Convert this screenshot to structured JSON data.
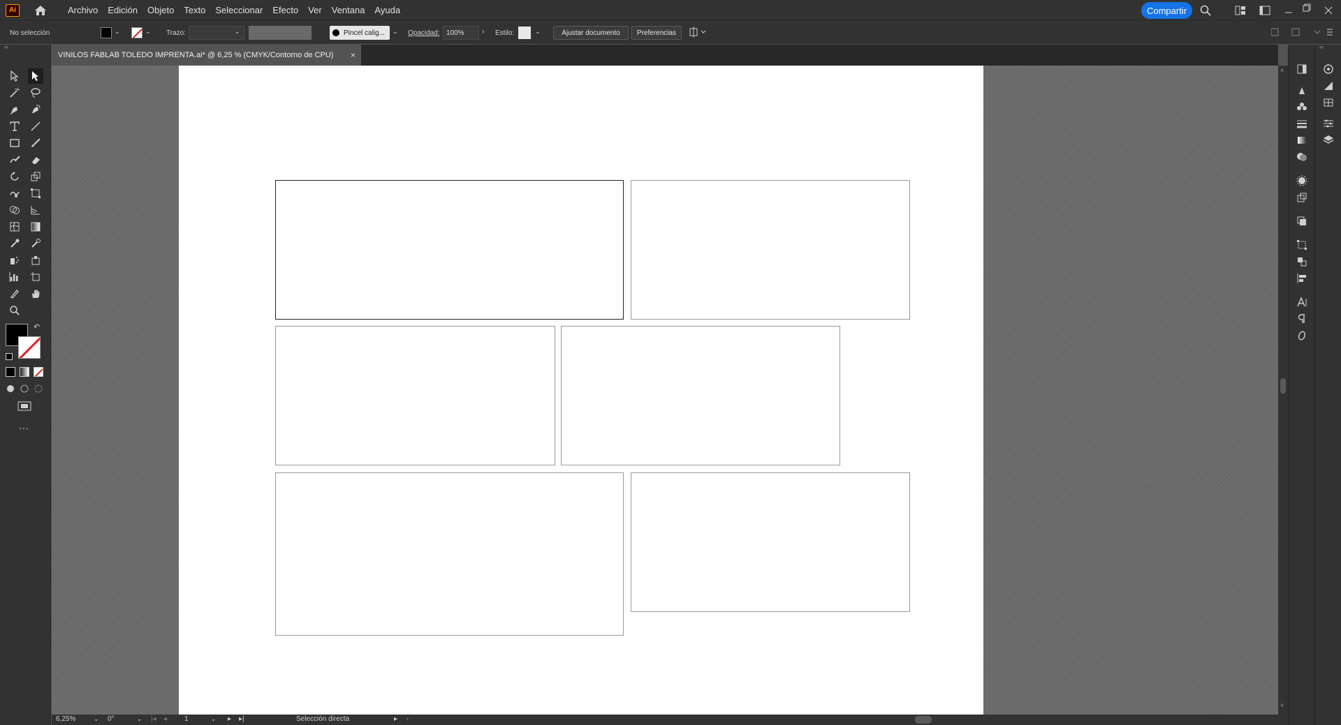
{
  "app": {
    "logo": "Ai"
  },
  "menu": [
    "Archivo",
    "Edición",
    "Objeto",
    "Texto",
    "Seleccionar",
    "Efecto",
    "Ver",
    "Ventana",
    "Ayuda"
  ],
  "share_label": "Compartir",
  "controlbar": {
    "selection": "No selección",
    "stroke_label": "Trazo:",
    "brush": "Pincel calig...",
    "opacity_label": "Opacidad:",
    "opacity_value": "100%",
    "style_label": "Estilo:",
    "fit_doc": "Ajustar documento",
    "prefs": "Preferencias"
  },
  "document": {
    "tab_title": "VINILOS FABLAB TOLEDO IMPRENTA.ai* @ 6,25 % (CMYK/Contorno de CPU)",
    "close": "×"
  },
  "statusbar": {
    "zoom": "6,25%",
    "rotation": "0°",
    "artboard": "1",
    "tool": "Selección directa"
  },
  "toolbar": {
    "more": "..."
  },
  "icons": [
    "selection-icon",
    "direct-selection-icon",
    "magic-wand-icon",
    "lasso-icon",
    "pen-icon",
    "curvature-icon",
    "type-icon",
    "line-icon",
    "rectangle-icon",
    "paintbrush-icon",
    "shaper-icon",
    "eraser-icon",
    "rotate-icon",
    "scale-icon",
    "warp-icon",
    "free-transform-icon",
    "shape-builder-icon",
    "perspective-icon",
    "mesh-icon",
    "gradient-icon",
    "eyedropper-icon",
    "blend-icon",
    "symbol-sprayer-icon",
    "graph-icon",
    "artboard-icon",
    "slice-icon",
    "hand-icon",
    "zoom-icon"
  ]
}
